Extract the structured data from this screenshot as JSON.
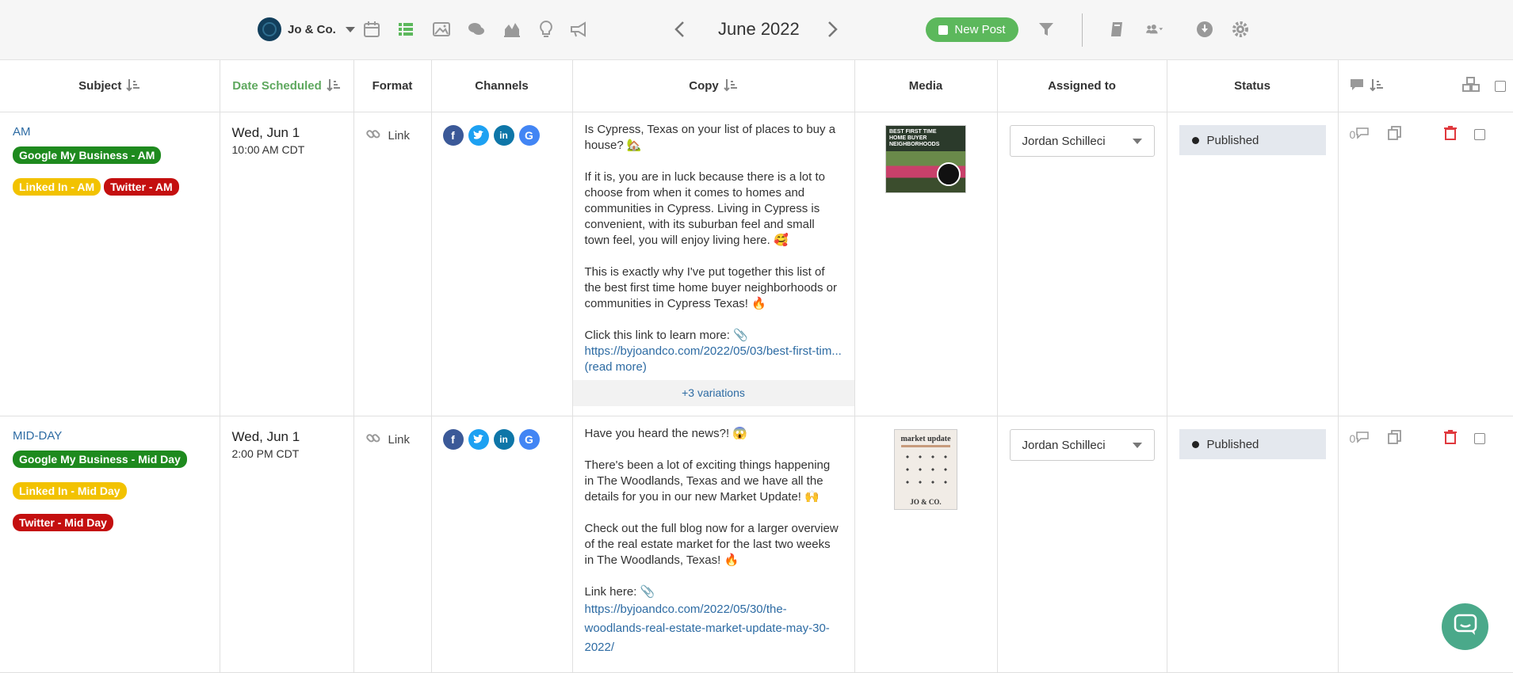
{
  "header": {
    "brand": "Jo & Co.",
    "month": "June 2022",
    "new_post_label": "New Post"
  },
  "columns": {
    "subject": "Subject",
    "date_scheduled": "Date Scheduled",
    "format": "Format",
    "channels": "Channels",
    "copy": "Copy",
    "media": "Media",
    "assigned_to": "Assigned to",
    "status": "Status"
  },
  "rows": [
    {
      "subject": "AM",
      "tags": [
        "Google My Business - AM",
        "Linked In - AM",
        "Twitter - AM"
      ],
      "date": "Wed, Jun 1",
      "time": "10:00 AM CDT",
      "format": "Link",
      "copy": [
        "Is Cypress, Texas on your list of places to buy a house? 🏡",
        "If it is, you are in luck because there is a lot to choose from when it comes to homes and communities in Cypress. Living in Cypress is convenient, with its suburban feel and small town feel, you will enjoy living here. 🥰",
        "This is exactly why I've put together this list of the best first time home buyer neighborhoods or communities in Cypress Texas! 🔥",
        "Click this link to learn more: 📎"
      ],
      "link": "https://byjoandco.com/2022/05/03/best-first-tim...",
      "read_more": "(read more)",
      "variations": "+3 variations",
      "media_text": "BEST FIRST TIME HOME BUYER NEIGHBORHOODS",
      "assigned": "Jordan Schilleci",
      "status": "Published",
      "comments": "0"
    },
    {
      "subject": "MID-DAY",
      "tags": [
        "Google My Business - Mid Day",
        "Linked In - Mid Day",
        "Twitter - Mid Day"
      ],
      "date": "Wed, Jun 1",
      "time": "2:00 PM CDT",
      "format": "Link",
      "copy": [
        "Have you heard the news?! 😱",
        "There's been a lot of exciting things happening in The Woodlands, Texas and we have all the details for you in our new Market Update! 🙌",
        "Check out the full blog now for a larger overview of the real estate market for the last two weeks in The Woodlands, Texas! 🔥",
        "Link here: 📎"
      ],
      "link": "https://byjoandco.com/2022/05/30/the-woodlands-real-estate-market-update-may-30-2022/",
      "media_title": "market update",
      "media_footer": "JO & CO.",
      "assigned": "Jordan Schilleci",
      "status": "Published",
      "comments": "0"
    }
  ],
  "colors": {
    "accent_green": "#5cb85c",
    "tag_green": "#1e8a1e",
    "tag_yellow": "#f2c200",
    "tag_red": "#c40f0f",
    "link_blue": "#2d6ba3"
  }
}
